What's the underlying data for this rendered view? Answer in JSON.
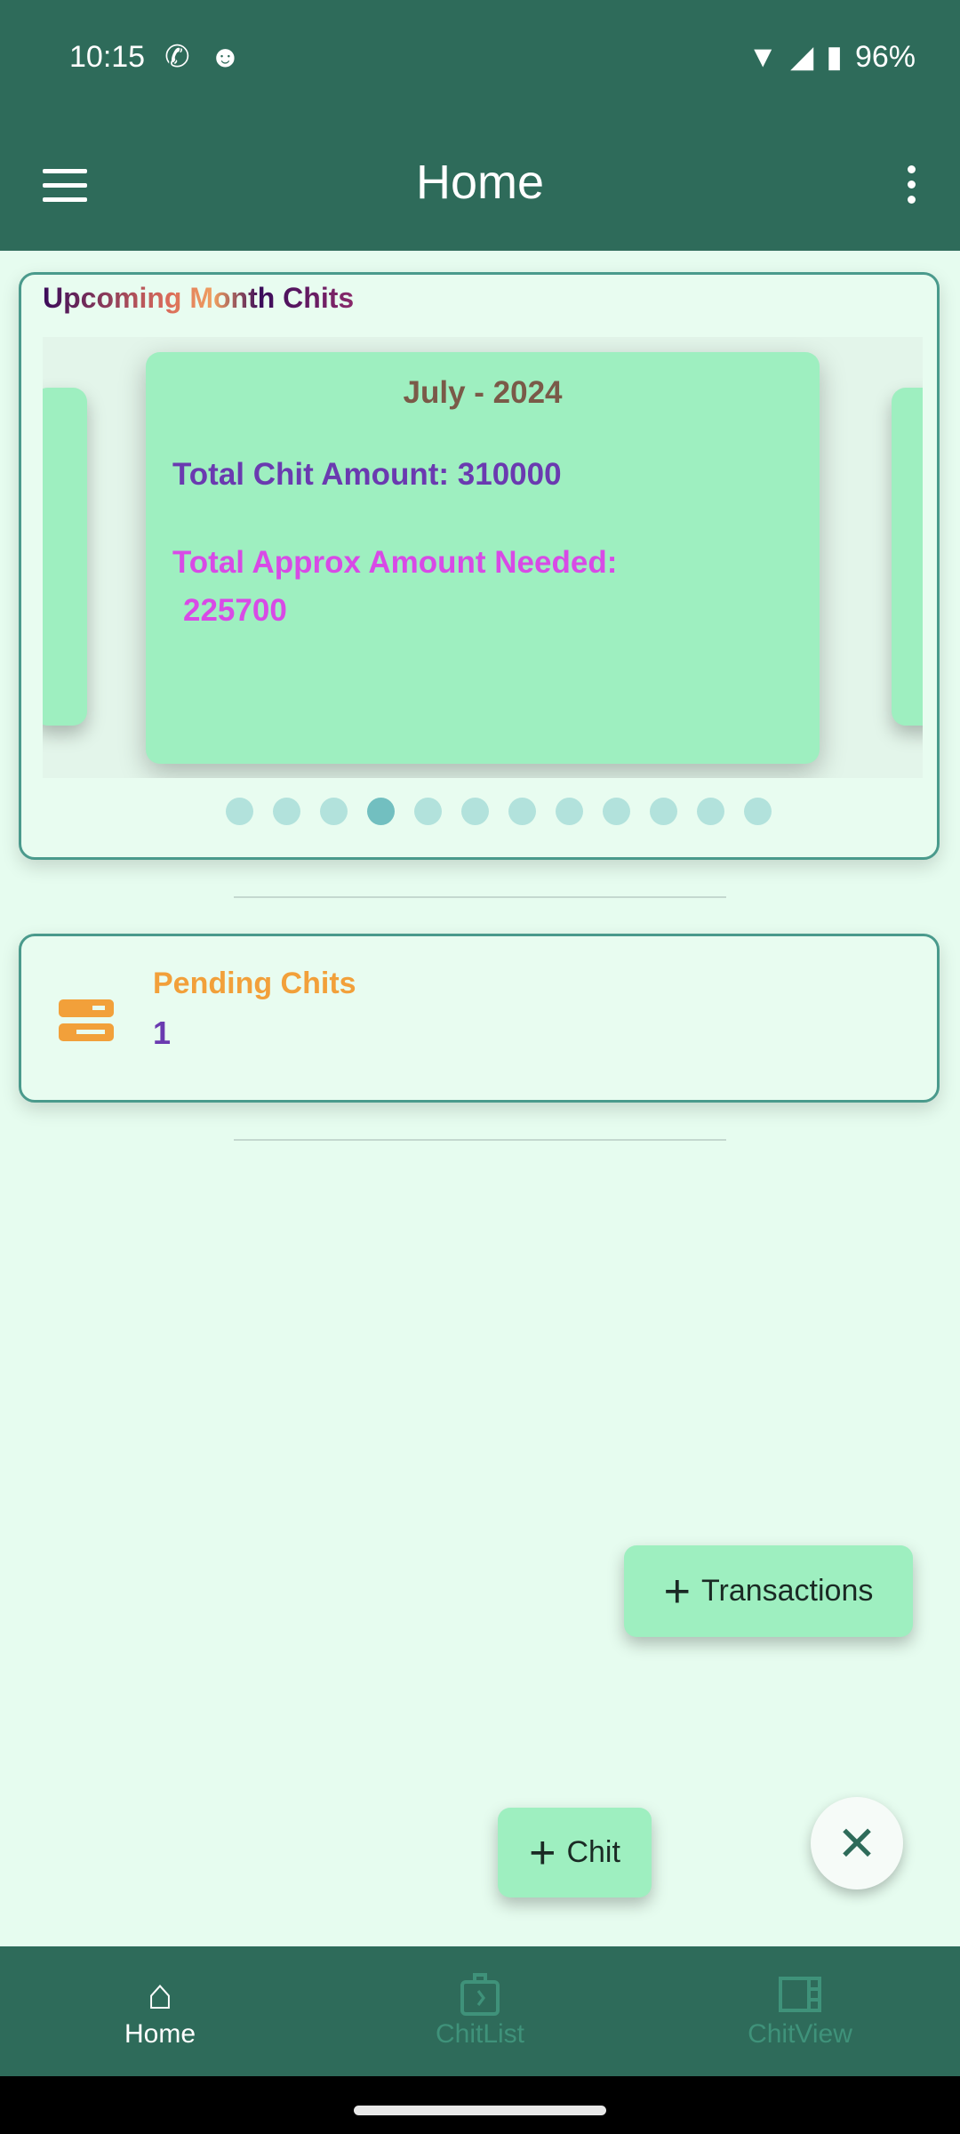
{
  "status_bar": {
    "time": "10:15",
    "battery": "96%",
    "icons": [
      "whatsapp-icon",
      "cat-icon",
      "wifi-icon",
      "signal-icon",
      "battery-charging-icon"
    ]
  },
  "app_bar": {
    "title": "Home",
    "menu_icon": "hamburger-icon",
    "more_icon": "more-vert-icon"
  },
  "upcoming": {
    "title": "Upcoming Month Chits",
    "card": {
      "month": "July - 2024",
      "total_chit_amount": "Total Chit Amount: 310000",
      "total_approx_label": "Total Approx Amount Needed:",
      "total_approx_value": "225700"
    },
    "page_count": 12,
    "active_page": 4
  },
  "pending": {
    "title": "Pending Chits",
    "value": "1",
    "icon": "storage-icon"
  },
  "fabs": {
    "transactions": "Transactions",
    "chit": "Chit",
    "close_icon": "close-icon"
  },
  "nav": {
    "items": [
      {
        "label": "Home",
        "icon": "home-icon",
        "active": true
      },
      {
        "label": "ChitList",
        "icon": "chitlist-icon",
        "active": false
      },
      {
        "label": "ChitView",
        "icon": "chitview-icon",
        "active": false
      }
    ]
  },
  "colors": {
    "primary": "#2e6b5a",
    "card_green": "#9eefc0",
    "background": "#e6fcef",
    "orange": "#f2a03a",
    "purple": "#6a3ab0",
    "magenta": "#d84ae6"
  }
}
